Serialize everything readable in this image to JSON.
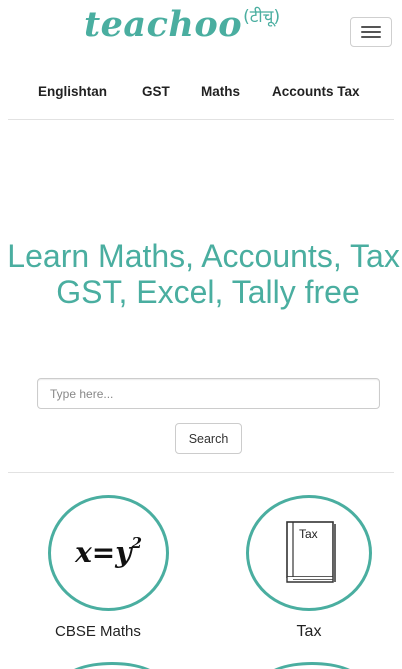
{
  "header": {
    "logo_text": "teachoo",
    "logo_suffix": "(टीचू)"
  },
  "nav": {
    "items": [
      {
        "label": "Englishtan"
      },
      {
        "label": "GST"
      },
      {
        "label": "Maths"
      },
      {
        "label": "Accounts Tax"
      }
    ]
  },
  "hero": {
    "title": "Learn Maths, Accounts, Tax, GST, Excel, Tally free"
  },
  "search": {
    "placeholder": "Type here...",
    "value": "",
    "button_label": "Search"
  },
  "categories": [
    {
      "label": "CBSE Maths",
      "icon": "formula-icon",
      "formula": "x=y",
      "exponent": "2"
    },
    {
      "label": "Tax",
      "icon": "tax-book-icon",
      "book_text": "Tax"
    }
  ],
  "colors": {
    "brand": "#4aaea0",
    "divider": "#e2e2e2",
    "border": "#cccccc"
  }
}
